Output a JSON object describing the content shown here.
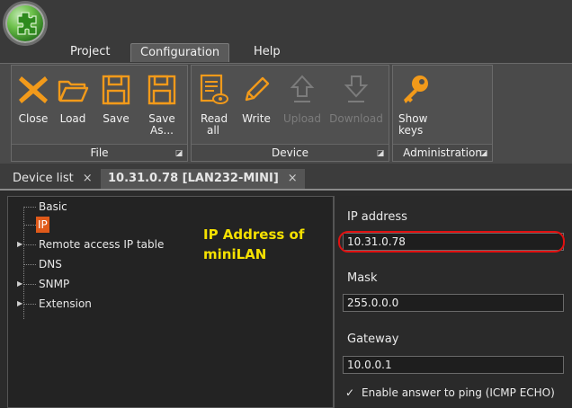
{
  "menu": {
    "tabs": [
      {
        "label": "Project"
      },
      {
        "label": "Configuration"
      },
      {
        "label": "Help"
      }
    ]
  },
  "ribbon": {
    "groups": [
      {
        "label": "File",
        "buttons": [
          {
            "label": "Close",
            "icon": "close-icon"
          },
          {
            "label": "Load",
            "icon": "folder-open-icon"
          },
          {
            "label": "Save",
            "icon": "save-icon"
          },
          {
            "label": "Save As...",
            "icon": "save-as-icon"
          }
        ]
      },
      {
        "label": "Device",
        "buttons": [
          {
            "label": "Read all",
            "icon": "read-all-icon"
          },
          {
            "label": "Write",
            "icon": "pencil-icon"
          },
          {
            "label": "Upload",
            "icon": "upload-icon",
            "disabled": true
          },
          {
            "label": "Download",
            "icon": "download-icon",
            "disabled": true
          }
        ]
      },
      {
        "label": "Administration",
        "buttons": [
          {
            "label": "Show keys",
            "icon": "key-icon"
          }
        ]
      }
    ],
    "accent": "#f29a1a",
    "disabled_color": "#7c7c7c"
  },
  "doc_tabs": [
    {
      "label": "Device list",
      "close": "×"
    },
    {
      "label": "10.31.0.78 [LAN232-MINI]",
      "close": "×",
      "active": true
    }
  ],
  "tree": {
    "items": [
      {
        "label": "Basic"
      },
      {
        "label": "IP",
        "selected": true
      },
      {
        "label": "Remote access IP table",
        "expandable": true
      },
      {
        "label": "DNS"
      },
      {
        "label": "SNMP",
        "expandable": true
      },
      {
        "label": "Extension",
        "expandable": true
      }
    ],
    "selection_color": "#e05a1a"
  },
  "annotation": {
    "line1": "IP Address of",
    "line2": "miniLAN",
    "color": "#f5e100"
  },
  "properties": {
    "ip": {
      "label": "IP address",
      "value": "10.31.0.78"
    },
    "mask": {
      "label": "Mask",
      "value": "255.0.0.0"
    },
    "gateway": {
      "label": "Gateway",
      "value": "10.0.0.1"
    },
    "ping": {
      "label": "Enable answer to ping (ICMP ECHO)",
      "checked": true,
      "check_glyph": "✓"
    },
    "highlight_color": "#e01010"
  }
}
